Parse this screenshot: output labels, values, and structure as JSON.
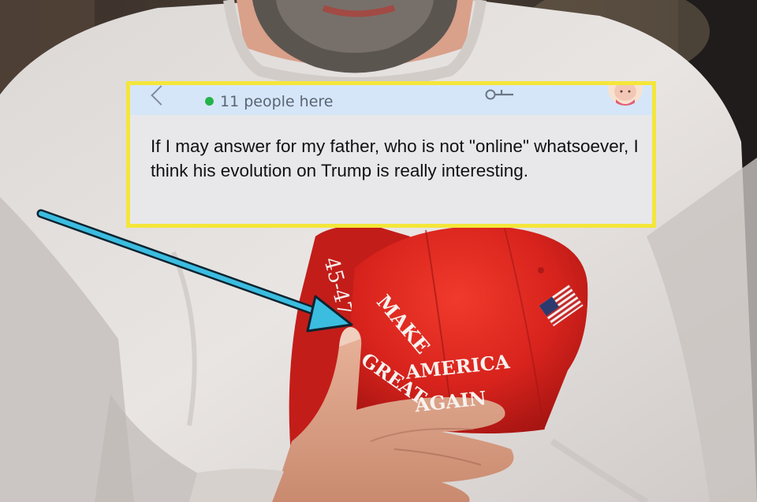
{
  "card": {
    "status": "11 people here",
    "message": "If I may answer for my father, who is not \"online\" whatsoever, I think his evolution on Trump is really interesting."
  },
  "hat": {
    "line1": "MAKE",
    "line2": "AMERICA",
    "line3": "GREAT",
    "line4": "AGAIN",
    "side_text": "45-47"
  },
  "colors": {
    "highlight_border": "#f4e63a",
    "arrow": "#3bbde0",
    "hat_red": "#d8231d",
    "online_dot": "#25b34a"
  },
  "icons": [
    "back-chevron-icon",
    "online-dot-icon",
    "key-icon",
    "avatar-icon",
    "pointer-arrow-icon"
  ]
}
